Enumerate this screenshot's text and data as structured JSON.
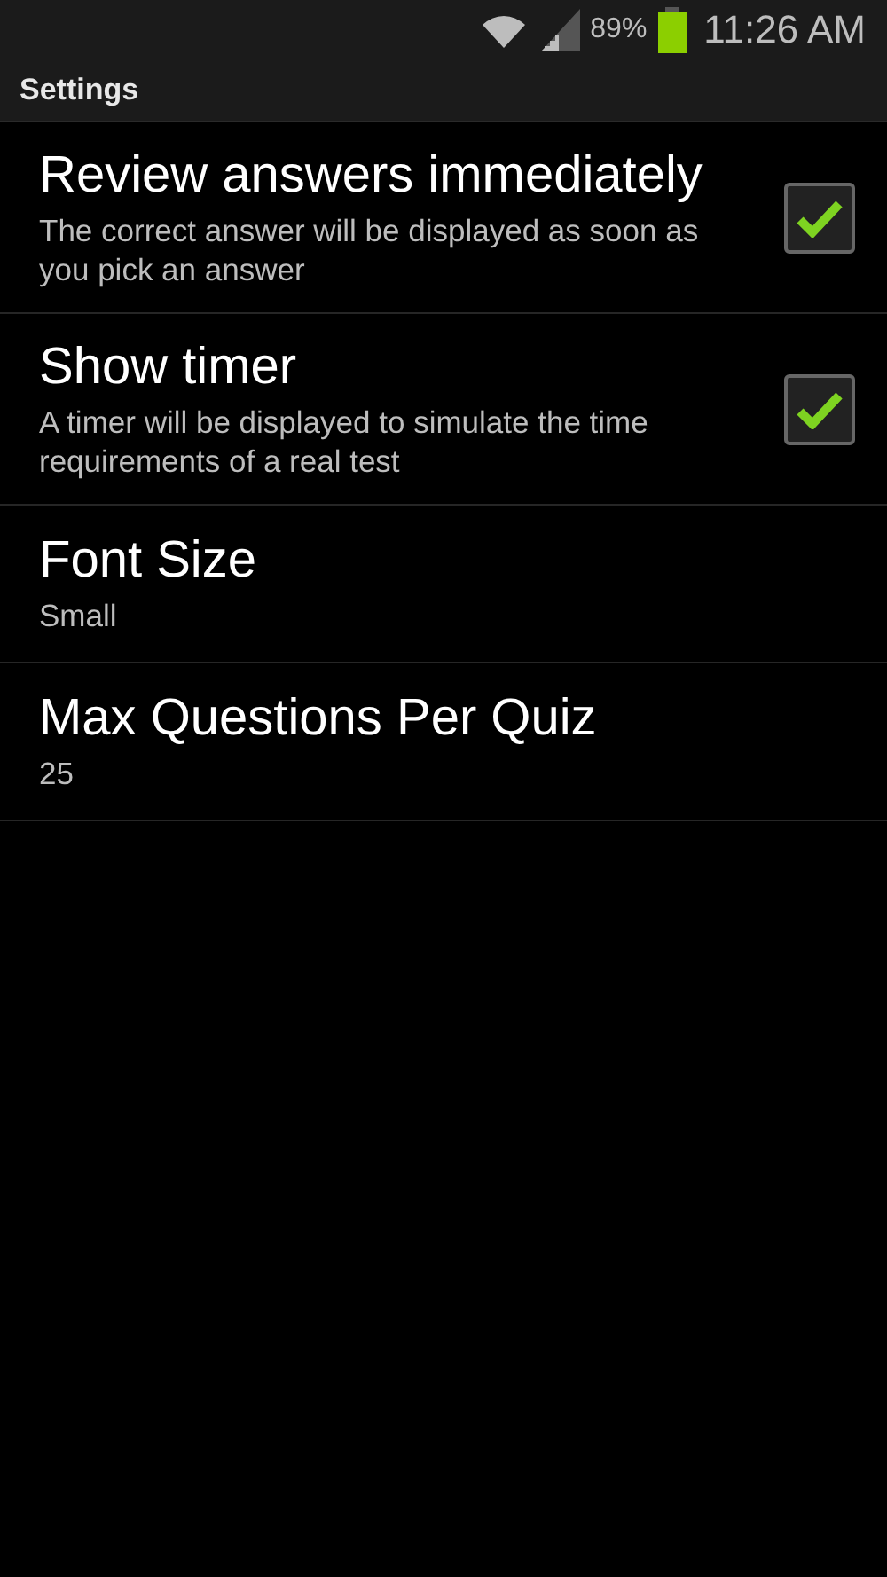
{
  "status_bar": {
    "battery": "89%",
    "time": "11:26 AM"
  },
  "title": "Settings",
  "settings": [
    {
      "kind": "checkbox",
      "title": "Review answers immediately",
      "summary": "The correct answer will be displayed as soon as you pick an answer",
      "checked": true
    },
    {
      "kind": "checkbox",
      "title": "Show timer",
      "summary": "A timer will be displayed to simulate the time requirements of a real test",
      "checked": true
    },
    {
      "kind": "plain",
      "title": "Font Size",
      "summary": "Small"
    },
    {
      "kind": "plain",
      "title": "Max Questions Per Quiz",
      "summary": "25"
    }
  ]
}
